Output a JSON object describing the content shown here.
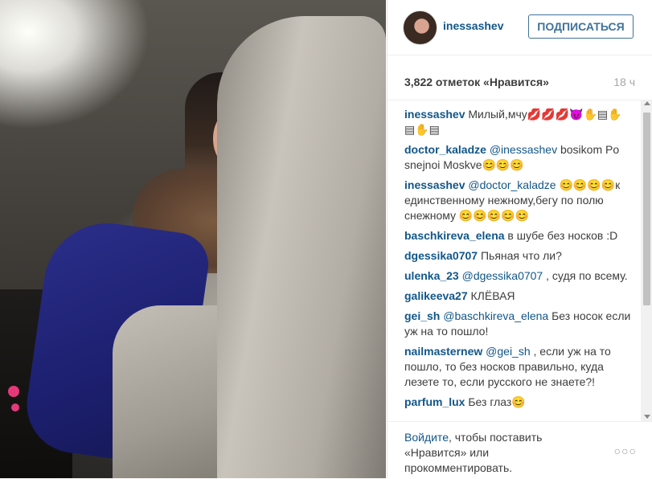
{
  "post": {
    "username": "inessashev",
    "follow_label": "ПОДПИСАТЬСЯ",
    "likes": "3,822 отметок «Нравится»",
    "time": "18 ч"
  },
  "comments": [
    {
      "user": "inessashev",
      "mention": "",
      "text": "Милый,мчу💋💋💋😈✋▤✋ ▤✋▤"
    },
    {
      "user": "doctor_kaladze",
      "mention": "@inessashev",
      "text": "bosikom Po snejnoi Moskve😊😊😊"
    },
    {
      "user": "inessashev",
      "mention": "@doctor_kaladze",
      "text": "😊😊😊😊к единственному нежному,бегу по полю снежному 😊😊😊😊😊"
    },
    {
      "user": "baschkireva_elena",
      "mention": "",
      "text": "в шубе без носков :D"
    },
    {
      "user": "dgessika0707",
      "mention": "",
      "text": "Пьяная что ли?"
    },
    {
      "user": "ulenka_23",
      "mention": "@dgessika0707",
      "text": ", судя по всему."
    },
    {
      "user": "galikeeva27",
      "mention": "",
      "text": "КЛЁВАЯ"
    },
    {
      "user": "gei_sh",
      "mention": "@baschkireva_elena",
      "text": "Без носок если уж на то пошло!"
    },
    {
      "user": "nailmasternew",
      "mention": "@gei_sh",
      "text": ", если уж на то пошло, то без носков правильно, куда лезете то, если русского не знаете?!"
    },
    {
      "user": "parfum_lux",
      "mention": "",
      "text": "Без глаз😊"
    }
  ],
  "footer": {
    "login_link": "Войдите",
    "login_text": ", чтобы поставить «Нравится» или прокомментировать.",
    "more": "○○○"
  }
}
